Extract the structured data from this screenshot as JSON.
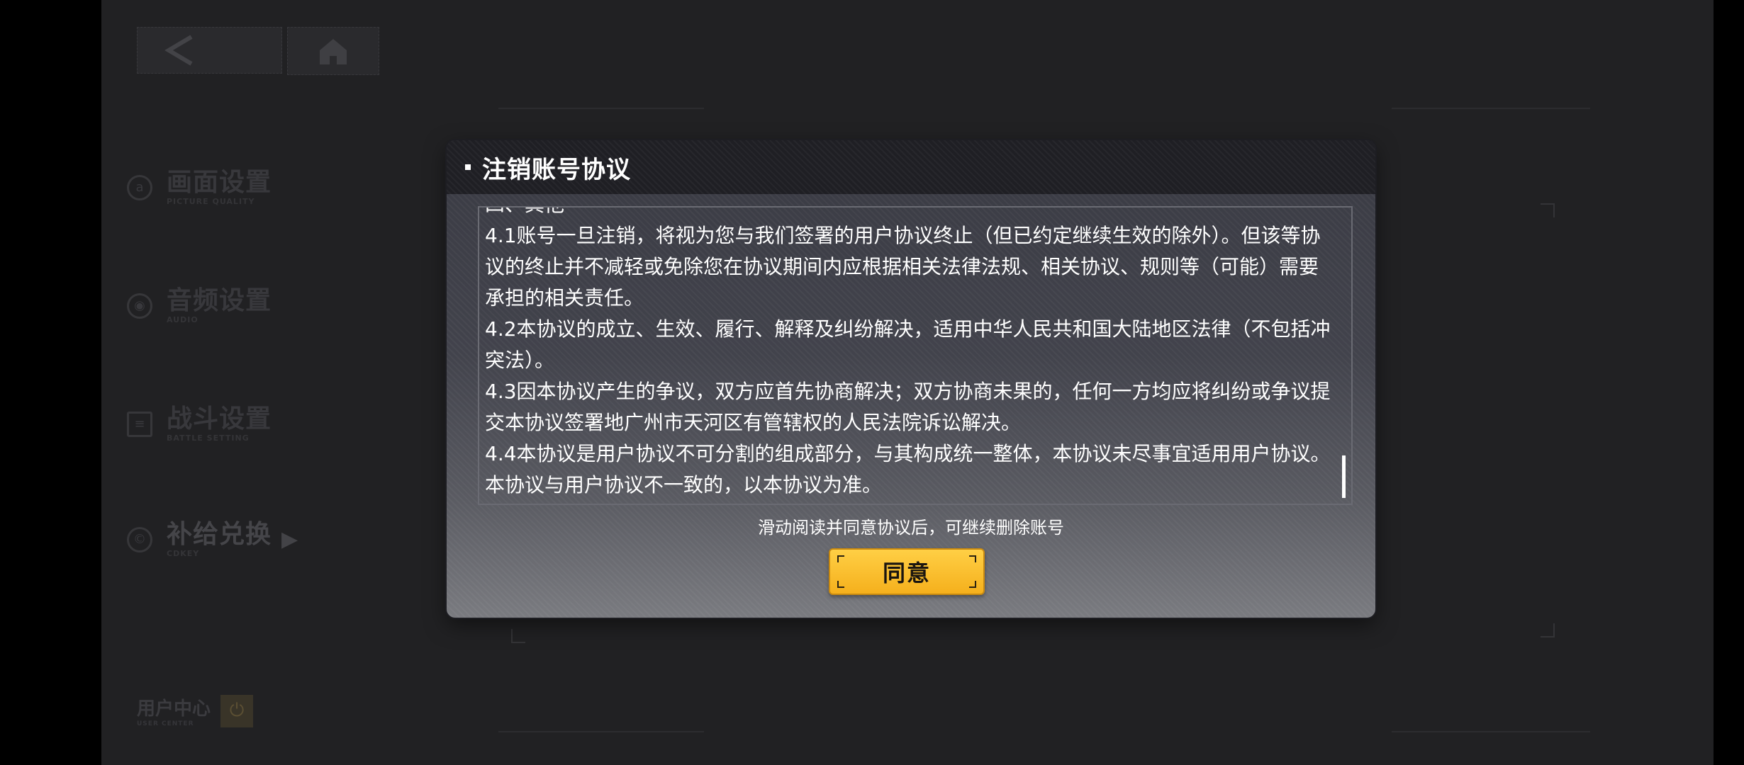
{
  "nav": {
    "back_icon": "chevron-left-icon",
    "home_icon": "home-icon"
  },
  "menu": [
    {
      "id": "picture",
      "label": "画面设置",
      "sub": "PICTURE QUALITY",
      "icon": "picture-icon"
    },
    {
      "id": "audio",
      "label": "音频设置",
      "sub": "AUDIO",
      "icon": "audio-icon"
    },
    {
      "id": "battle",
      "label": "战斗设置",
      "sub": "BATTLE SETTING",
      "icon": "battle-icon"
    },
    {
      "id": "cdkey",
      "label": "补给兑换",
      "sub": "CDKEY",
      "icon": "cdkey-icon",
      "active": true
    }
  ],
  "user_center": {
    "label": "用户中心",
    "sub": "USER CENTER",
    "icon": "power-icon"
  },
  "modal": {
    "title": "注销账号协议",
    "section_heading": "四、其他",
    "clauses": [
      "4.1账号一旦注销，将视为您与我们签署的用户协议终止（但已约定继续生效的除外）。但该等协议的终止并不减轻或免除您在协议期间内应根据相关法律法规、相关协议、规则等（可能）需要承担的相关责任。",
      "4.2本协议的成立、生效、履行、解释及纠纷解决，适用中华人民共和国大陆地区法律（不包括冲突法）。",
      "4.3因本协议产生的争议，双方应首先协商解决；双方协商未果的，任何一方均应将纠纷或争议提交本协议签署地广州市天河区有管辖权的人民法院诉讼解决。",
      "4.4本协议是用户协议不可分割的组成部分，与其构成统一整体，本协议未尽事宜适用用户协议。本协议与用户协议不一致的，以本协议为准。"
    ],
    "hint": "滑动阅读并同意协议后，可继续删除账号",
    "agree_label": "同意"
  },
  "colors": {
    "accent": "#f5b01c",
    "modal_header": "#1f1f24",
    "background": "#2c2c2f"
  }
}
